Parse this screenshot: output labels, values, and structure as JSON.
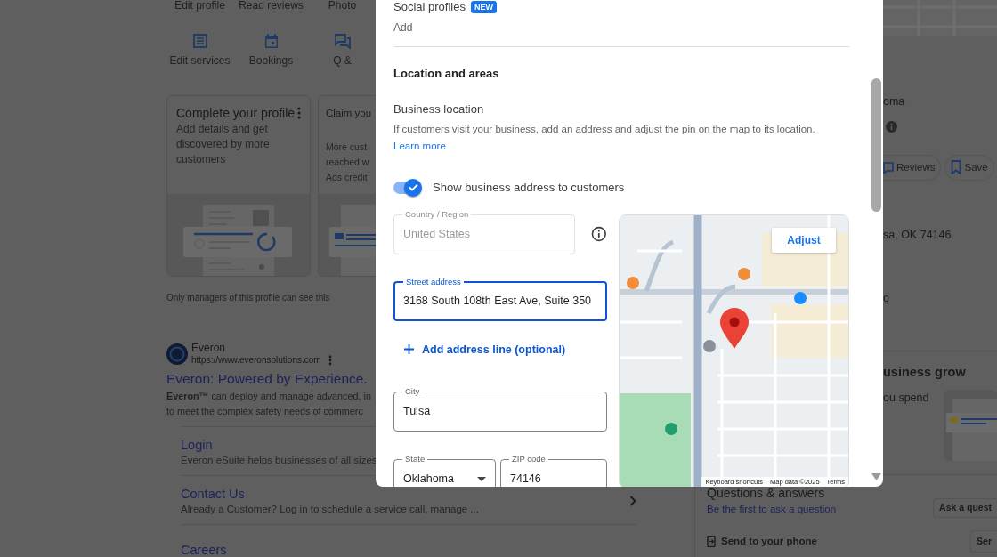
{
  "background_page": {
    "top_actions": [
      {
        "label": "Edit profile"
      },
      {
        "label": "Read reviews"
      },
      {
        "label": "Photo"
      }
    ],
    "quick_actions": [
      {
        "label": "Edit services"
      },
      {
        "label": "Bookings"
      },
      {
        "label": "Q &"
      }
    ],
    "cards": [
      {
        "kind": "full",
        "title": "Complete your profile",
        "body": "Add details and get discovered by more customers"
      },
      {
        "kind": "clipped",
        "title": "Claim you",
        "body_lines": [
          "More cust",
          "reached w",
          "Ads credit"
        ]
      }
    ],
    "managers_note": "Only managers of this profile can see this",
    "search_result": {
      "site_name": "Everon",
      "url": "https://www.everonsolutions.com",
      "title": "Everon: Powered by Experience.",
      "snippet_lines": [
        "**Everon™** can deploy and manage advanced, in",
        "to meet the complex safety needs of commerc"
      ],
      "sitelinks": [
        {
          "title": "Login",
          "description": "Everon eSuite helps businesses of all sizes"
        },
        {
          "title": "Contact Us",
          "description": "Already a Customer? Log in to schedule a service call, manage ...",
          "chevron": true
        },
        {
          "title": "Careers",
          "chevron": false
        }
      ]
    }
  },
  "business_panel": {
    "name_fragment": "oma",
    "action_buttons": [
      {
        "label": "Reviews"
      },
      {
        "label": "Save"
      }
    ],
    "address_fragment": "sa, OK 74146",
    "hours_fragment": "o",
    "ads_heading": "usiness grow",
    "ads_text": "ou spend",
    "questions": {
      "title": "Questions & answers",
      "link": "Be the first to ask a question",
      "ask_button": "Ask a quest"
    },
    "send_to_phone": "Send to your phone",
    "send_button": "Ser"
  },
  "dialog": {
    "social_profiles": {
      "label": "Social profiles",
      "badge": "NEW",
      "action": "Add"
    },
    "section_title": "Location and areas",
    "business_location": {
      "title": "Business location",
      "description": "If customers visit your business, add an address and adjust the pin on the map to its location.",
      "link": "Learn more"
    },
    "show_address": {
      "label": "Show business address to customers",
      "on": true
    },
    "form_rows": [
      {
        "items": [
          {
            "kind": "text",
            "label": "Country / Region",
            "value": "United States",
            "disabled": true,
            "focused": false,
            "info": true
          }
        ]
      },
      {
        "items": [
          {
            "kind": "text",
            "label": "Street address",
            "value": "3168 South 108th East Ave, Suite 350",
            "disabled": false,
            "focused": true,
            "info": false
          }
        ]
      },
      {
        "items": [
          {
            "kind": "add_line",
            "label": "Add address line (optional)"
          }
        ]
      },
      {
        "items": [
          {
            "kind": "text",
            "label": "City",
            "value": "Tulsa",
            "disabled": false,
            "focused": false,
            "info": false
          }
        ]
      },
      {
        "items": [
          {
            "kind": "select",
            "label": "State",
            "value": "Oklahoma",
            "disabled": false,
            "focused": false,
            "info": false
          },
          {
            "kind": "text",
            "label": "ZIP code",
            "value": "74146",
            "disabled": false,
            "focused": false,
            "info": false
          }
        ]
      }
    ],
    "map": {
      "button": "Adjust",
      "attribution": [
        "Keyboard shortcuts",
        "Map data ©2025",
        "Terms"
      ]
    }
  }
}
